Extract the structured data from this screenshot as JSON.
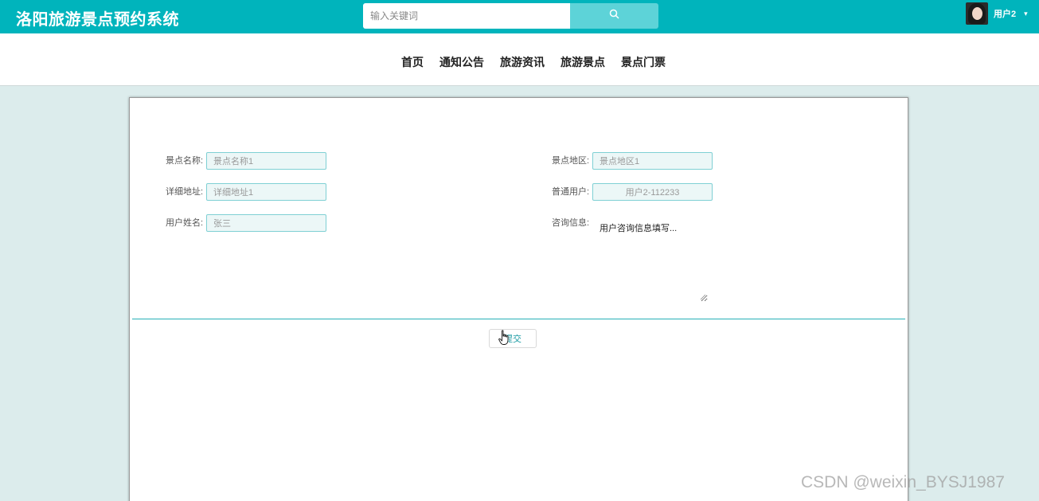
{
  "header": {
    "app_title": "洛阳旅游景点预约系统",
    "search_placeholder": "输入关键词",
    "user_name": "用户2",
    "accent_color": "#00b4bc"
  },
  "nav": {
    "items": [
      "首页",
      "通知公告",
      "旅游资讯",
      "旅游景点",
      "景点门票"
    ]
  },
  "form": {
    "scenic_name": {
      "label": "景点名称:",
      "value": "景点名称1"
    },
    "scenic_area": {
      "label": "景点地区:",
      "value": "景点地区1"
    },
    "address": {
      "label": "详细地址:",
      "value": "详细地址1"
    },
    "regular_user": {
      "label": "普通用户:",
      "value": "用户2-112233"
    },
    "user_real_name": {
      "label": "用户姓名:",
      "value": "张三"
    },
    "consult_info": {
      "label": "咨询信息:",
      "value": "用户咨询信息填写..."
    },
    "submit_label": "提交"
  },
  "watermark": "CSDN @weixin_BYSJ1987",
  "icons": {
    "search": "search-icon",
    "caret": "chevron-down-icon",
    "cursor": "hand-pointer-icon"
  }
}
